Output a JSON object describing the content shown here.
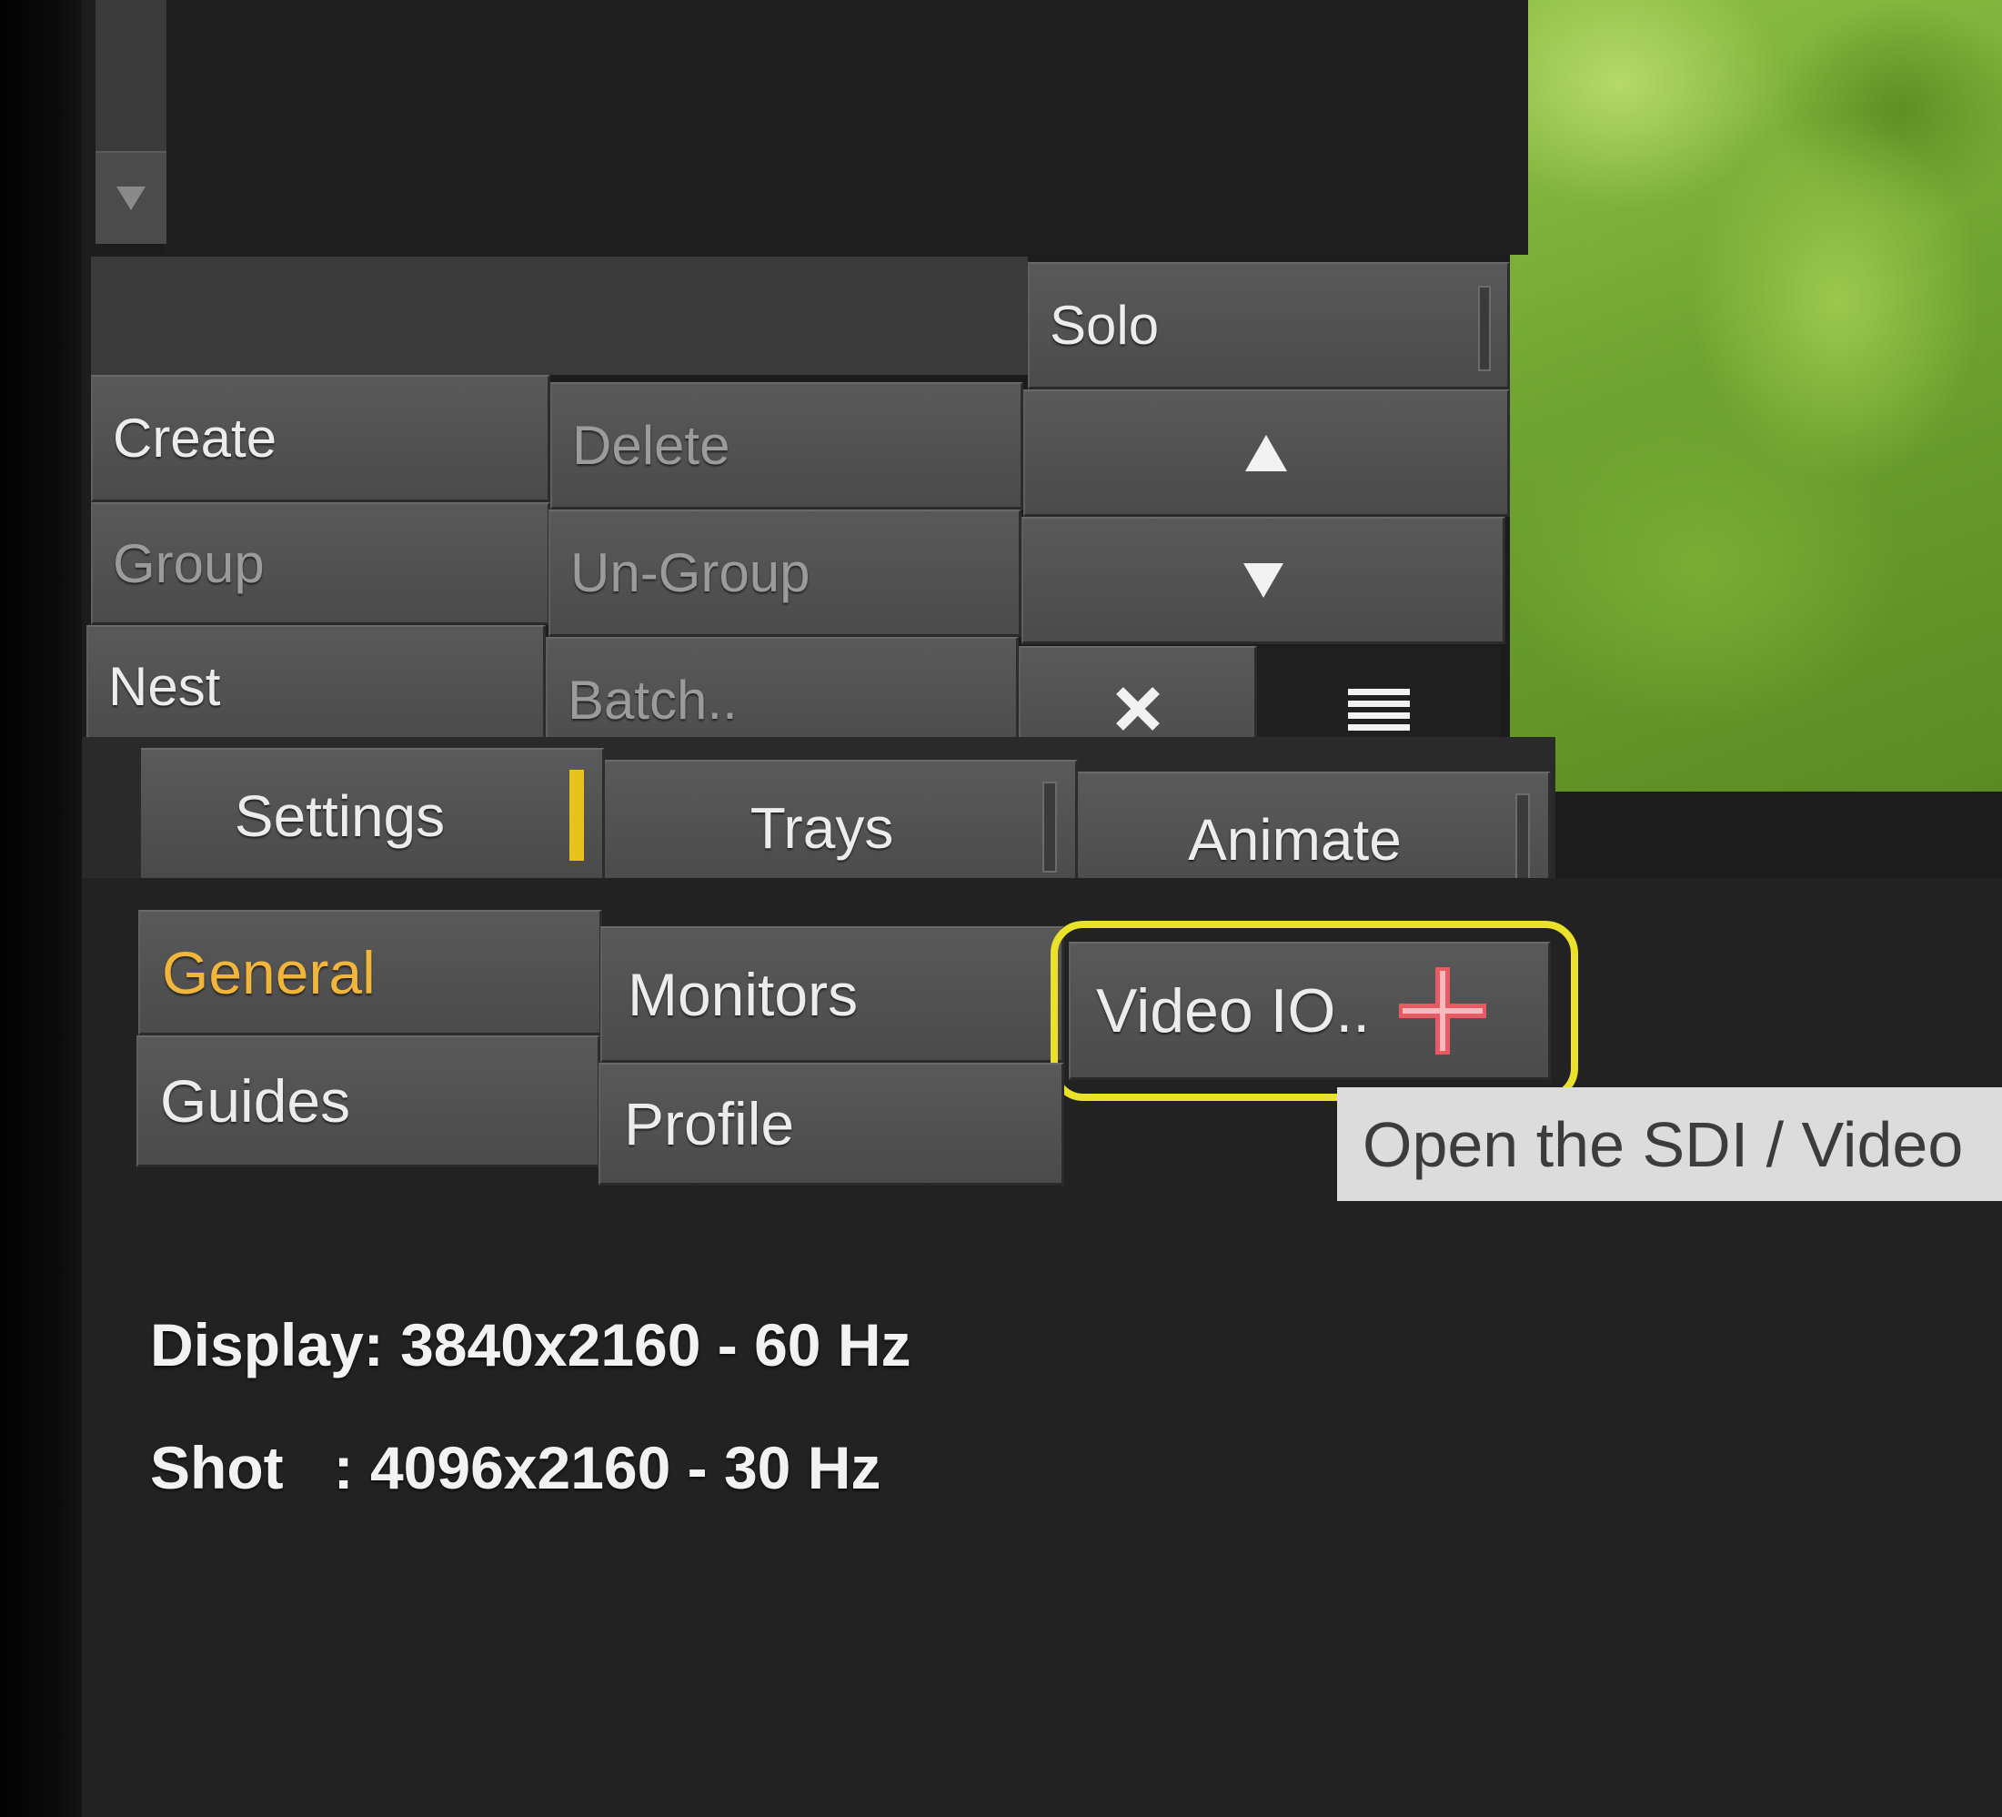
{
  "toolbar": {
    "solo": "Solo",
    "create": "Create",
    "delete": "Delete",
    "group": "Group",
    "ungroup": "Un-Group",
    "nest": "Nest",
    "batch": "Batch..",
    "move_up_icon": "triangle-up-icon",
    "move_down_icon": "triangle-down-icon",
    "close_icon": "close-icon",
    "menu_icon": "menu-icon"
  },
  "tabs": [
    {
      "label": "Settings",
      "active": true
    },
    {
      "label": "Trays",
      "active": false
    },
    {
      "label": "Animate",
      "active": false
    }
  ],
  "settings_buttons": {
    "general": "General",
    "monitors": "Monitors",
    "video_io": "Video IO..",
    "guides": "Guides",
    "profile": "Profile"
  },
  "tooltip": "Open the SDI / Video",
  "info": {
    "display": "Display: 3840x2160 - 60 Hz",
    "shot": "Shot   : 4096x2160 - 30 Hz"
  },
  "colors": {
    "active_accent": "#e8c21d",
    "general_label": "#f0b53a",
    "highlight_ring": "#e9e12a",
    "cursor": "#e85b63"
  }
}
